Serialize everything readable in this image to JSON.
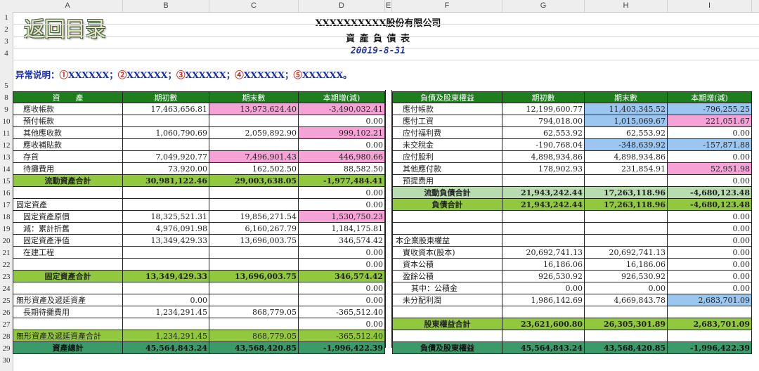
{
  "columns": [
    "A",
    "B",
    "C",
    "D",
    "E",
    "F",
    "G",
    "H",
    "I"
  ],
  "row_numbers": [
    "1",
    "2",
    "3",
    "4",
    "5",
    "8",
    "9",
    "10",
    "11",
    "12",
    "13",
    "14",
    "15",
    "16",
    "17",
    "18",
    "19",
    "20",
    "21",
    "22",
    "23",
    "24",
    "25",
    "26",
    "27",
    "28",
    "29",
    "30"
  ],
  "logo": "返回目录",
  "title": {
    "company": "XXXXXXXXXX股份有限公司",
    "report": "資 產 負 債 表",
    "date": "20019-8-31"
  },
  "notice": {
    "prefix": "异常说明：",
    "items": [
      {
        "num": "①",
        "text": "XXXXXX"
      },
      {
        "num": "②",
        "text": "XXXXXX"
      },
      {
        "num": "③",
        "text": "XXXXXX"
      },
      {
        "num": "④",
        "text": "XXXXXX"
      },
      {
        "num": "⑤",
        "text": "XXXXXX"
      }
    ],
    "sep": "；",
    "end": "。"
  },
  "header": {
    "left": [
      "資　　產",
      "期初數",
      "期末數",
      "本期增(減)"
    ],
    "right": [
      "負債及股東權益",
      "期初數",
      "期末數",
      "本期增(減)"
    ]
  },
  "colors": {
    "green_dark": "#1e7e1e",
    "green_total": "#92c83e",
    "green_light": "#b8dcb0",
    "pink": "#f5a3d6",
    "blue": "#9ac6ef",
    "teal": "#3a9a6a"
  },
  "left_rows": [
    [
      "應收帳款",
      "17,463,656.81",
      "13,973,624.40",
      "-3,490,032.41"
    ],
    [
      "預付帳款",
      "",
      "",
      "0.00"
    ],
    [
      "其他應收款",
      "1,060,790.69",
      "2,059,892.90",
      "999,102.21"
    ],
    [
      "應收補貼款",
      "",
      "",
      "0.00"
    ],
    [
      "存貨",
      "7,049,920.77",
      "7,496,901.43",
      "446,980.66"
    ],
    [
      "待攤費用",
      "73,920.00",
      "162,502.50",
      "88,582.50"
    ],
    [
      "流動資產合計",
      "30,981,122.46",
      "29,003,638.05",
      "-1,977,484.41"
    ],
    [
      "",
      "",
      "",
      "0.00"
    ],
    [
      "固定資產",
      "",
      "",
      "0.00"
    ],
    [
      "固定資產原價",
      "18,325,521.31",
      "19,856,271.54",
      "1,530,750.23"
    ],
    [
      "減：累計折舊",
      "4,976,091.98",
      "6,160,267.79",
      "1,184,175.81"
    ],
    [
      "固定資產淨值",
      "13,349,429.33",
      "13,696,003.75",
      "346,574.42"
    ],
    [
      "在建工程",
      "",
      "",
      "0.00"
    ],
    [
      "",
      "",
      "",
      "0.00"
    ],
    [
      "固定資產合計",
      "13,349,429.33",
      "13,696,003.75",
      "346,574.42"
    ],
    [
      "",
      "",
      "",
      "0.00"
    ],
    [
      "無形資產及遞延資產",
      "0.00",
      "",
      "0.00"
    ],
    [
      "長期待攤費用",
      "1,234,291.45",
      "868,779.05",
      "-365,512.40"
    ],
    [
      "",
      "",
      "",
      "0.00"
    ],
    [
      "無形資產及遞延資產合計",
      "1,234,291.45",
      "868,779.05",
      "-365,512.40"
    ],
    [
      "資產總計",
      "45,564,843.24",
      "43,568,420.85",
      "-1,996,422.39"
    ]
  ],
  "right_rows": [
    [
      "應付帳款",
      "12,199,600.77",
      "11,403,345.52",
      "-796,255.25"
    ],
    [
      "應付工資",
      "794,018.00",
      "1,015,069.67",
      "221,051.67"
    ],
    [
      "应付福利费",
      "62,553.92",
      "62,553.92",
      "0.00"
    ],
    [
      "未交稅金",
      "-190,768.04",
      "-348,639.92",
      "-157,871.88"
    ],
    [
      "应付股利",
      "4,898,934.86",
      "4,898,934.86",
      "0.00"
    ],
    [
      "其他應付款",
      "178,902.93",
      "231,854.91",
      "52,951.98"
    ],
    [
      "预提费用",
      "",
      "",
      "0.00"
    ],
    [
      "流動負債合計",
      "21,943,242.44",
      "17,263,118.96",
      "-4,680,123.48"
    ],
    [
      "負債合計",
      "21,943,242.44",
      "17,263,118.96",
      "-4,680,123.48"
    ],
    [
      "",
      "",
      "",
      "0.00"
    ],
    [
      "",
      "",
      "",
      "0.00"
    ],
    [
      "本企業股東權益",
      "",
      "",
      "0.00"
    ],
    [
      "實收資本(股本)",
      "20,692,741.13",
      "20,692,741.13",
      "0.00"
    ],
    [
      "資本公積",
      "16,186.06",
      "16,186.06",
      "0.00"
    ],
    [
      "盈餘公積",
      "926,530.92",
      "926,530.92",
      "0.00"
    ],
    [
      "其中：公積金",
      "0.00",
      "0.00",
      "0.00"
    ],
    [
      "未分配利潤",
      "1,986,142.69",
      "4,669,843.78",
      "2,683,701.09"
    ],
    [
      "",
      "",
      "",
      ""
    ],
    [
      "股東權益合計",
      "23,621,600.80",
      "26,305,301.89",
      "2,683,701.09"
    ],
    [
      "",
      "",
      "",
      ""
    ],
    [
      "負債及股東權益",
      "45,564,843.24",
      "43,568,420.85",
      "-1,996,422.39"
    ]
  ]
}
